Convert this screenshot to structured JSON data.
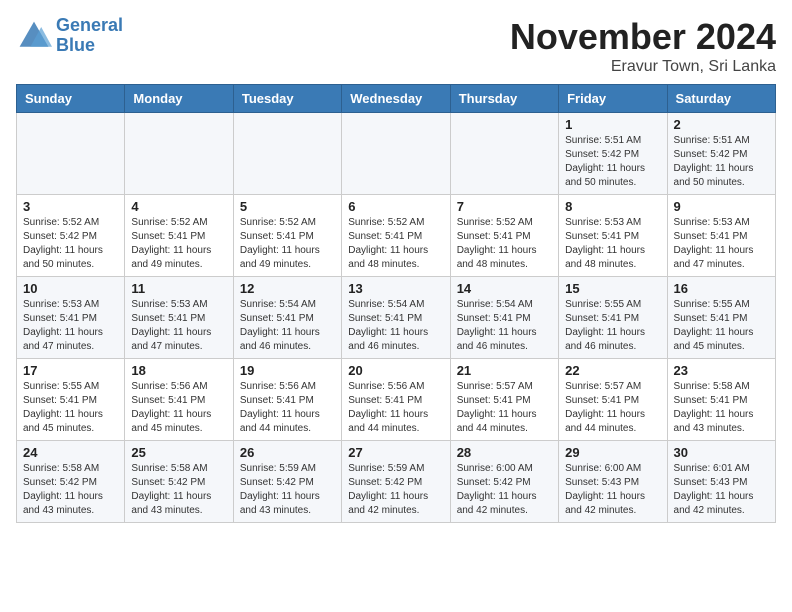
{
  "header": {
    "logo_line1": "General",
    "logo_line2": "Blue",
    "month": "November 2024",
    "location": "Eravur Town, Sri Lanka"
  },
  "weekdays": [
    "Sunday",
    "Monday",
    "Tuesday",
    "Wednesday",
    "Thursday",
    "Friday",
    "Saturday"
  ],
  "weeks": [
    [
      {
        "day": "",
        "info": ""
      },
      {
        "day": "",
        "info": ""
      },
      {
        "day": "",
        "info": ""
      },
      {
        "day": "",
        "info": ""
      },
      {
        "day": "",
        "info": ""
      },
      {
        "day": "1",
        "info": "Sunrise: 5:51 AM\nSunset: 5:42 PM\nDaylight: 11 hours\nand 50 minutes."
      },
      {
        "day": "2",
        "info": "Sunrise: 5:51 AM\nSunset: 5:42 PM\nDaylight: 11 hours\nand 50 minutes."
      }
    ],
    [
      {
        "day": "3",
        "info": "Sunrise: 5:52 AM\nSunset: 5:42 PM\nDaylight: 11 hours\nand 50 minutes."
      },
      {
        "day": "4",
        "info": "Sunrise: 5:52 AM\nSunset: 5:41 PM\nDaylight: 11 hours\nand 49 minutes."
      },
      {
        "day": "5",
        "info": "Sunrise: 5:52 AM\nSunset: 5:41 PM\nDaylight: 11 hours\nand 49 minutes."
      },
      {
        "day": "6",
        "info": "Sunrise: 5:52 AM\nSunset: 5:41 PM\nDaylight: 11 hours\nand 48 minutes."
      },
      {
        "day": "7",
        "info": "Sunrise: 5:52 AM\nSunset: 5:41 PM\nDaylight: 11 hours\nand 48 minutes."
      },
      {
        "day": "8",
        "info": "Sunrise: 5:53 AM\nSunset: 5:41 PM\nDaylight: 11 hours\nand 48 minutes."
      },
      {
        "day": "9",
        "info": "Sunrise: 5:53 AM\nSunset: 5:41 PM\nDaylight: 11 hours\nand 47 minutes."
      }
    ],
    [
      {
        "day": "10",
        "info": "Sunrise: 5:53 AM\nSunset: 5:41 PM\nDaylight: 11 hours\nand 47 minutes."
      },
      {
        "day": "11",
        "info": "Sunrise: 5:53 AM\nSunset: 5:41 PM\nDaylight: 11 hours\nand 47 minutes."
      },
      {
        "day": "12",
        "info": "Sunrise: 5:54 AM\nSunset: 5:41 PM\nDaylight: 11 hours\nand 46 minutes."
      },
      {
        "day": "13",
        "info": "Sunrise: 5:54 AM\nSunset: 5:41 PM\nDaylight: 11 hours\nand 46 minutes."
      },
      {
        "day": "14",
        "info": "Sunrise: 5:54 AM\nSunset: 5:41 PM\nDaylight: 11 hours\nand 46 minutes."
      },
      {
        "day": "15",
        "info": "Sunrise: 5:55 AM\nSunset: 5:41 PM\nDaylight: 11 hours\nand 46 minutes."
      },
      {
        "day": "16",
        "info": "Sunrise: 5:55 AM\nSunset: 5:41 PM\nDaylight: 11 hours\nand 45 minutes."
      }
    ],
    [
      {
        "day": "17",
        "info": "Sunrise: 5:55 AM\nSunset: 5:41 PM\nDaylight: 11 hours\nand 45 minutes."
      },
      {
        "day": "18",
        "info": "Sunrise: 5:56 AM\nSunset: 5:41 PM\nDaylight: 11 hours\nand 45 minutes."
      },
      {
        "day": "19",
        "info": "Sunrise: 5:56 AM\nSunset: 5:41 PM\nDaylight: 11 hours\nand 44 minutes."
      },
      {
        "day": "20",
        "info": "Sunrise: 5:56 AM\nSunset: 5:41 PM\nDaylight: 11 hours\nand 44 minutes."
      },
      {
        "day": "21",
        "info": "Sunrise: 5:57 AM\nSunset: 5:41 PM\nDaylight: 11 hours\nand 44 minutes."
      },
      {
        "day": "22",
        "info": "Sunrise: 5:57 AM\nSunset: 5:41 PM\nDaylight: 11 hours\nand 44 minutes."
      },
      {
        "day": "23",
        "info": "Sunrise: 5:58 AM\nSunset: 5:41 PM\nDaylight: 11 hours\nand 43 minutes."
      }
    ],
    [
      {
        "day": "24",
        "info": "Sunrise: 5:58 AM\nSunset: 5:42 PM\nDaylight: 11 hours\nand 43 minutes."
      },
      {
        "day": "25",
        "info": "Sunrise: 5:58 AM\nSunset: 5:42 PM\nDaylight: 11 hours\nand 43 minutes."
      },
      {
        "day": "26",
        "info": "Sunrise: 5:59 AM\nSunset: 5:42 PM\nDaylight: 11 hours\nand 43 minutes."
      },
      {
        "day": "27",
        "info": "Sunrise: 5:59 AM\nSunset: 5:42 PM\nDaylight: 11 hours\nand 42 minutes."
      },
      {
        "day": "28",
        "info": "Sunrise: 6:00 AM\nSunset: 5:42 PM\nDaylight: 11 hours\nand 42 minutes."
      },
      {
        "day": "29",
        "info": "Sunrise: 6:00 AM\nSunset: 5:43 PM\nDaylight: 11 hours\nand 42 minutes."
      },
      {
        "day": "30",
        "info": "Sunrise: 6:01 AM\nSunset: 5:43 PM\nDaylight: 11 hours\nand 42 minutes."
      }
    ]
  ]
}
